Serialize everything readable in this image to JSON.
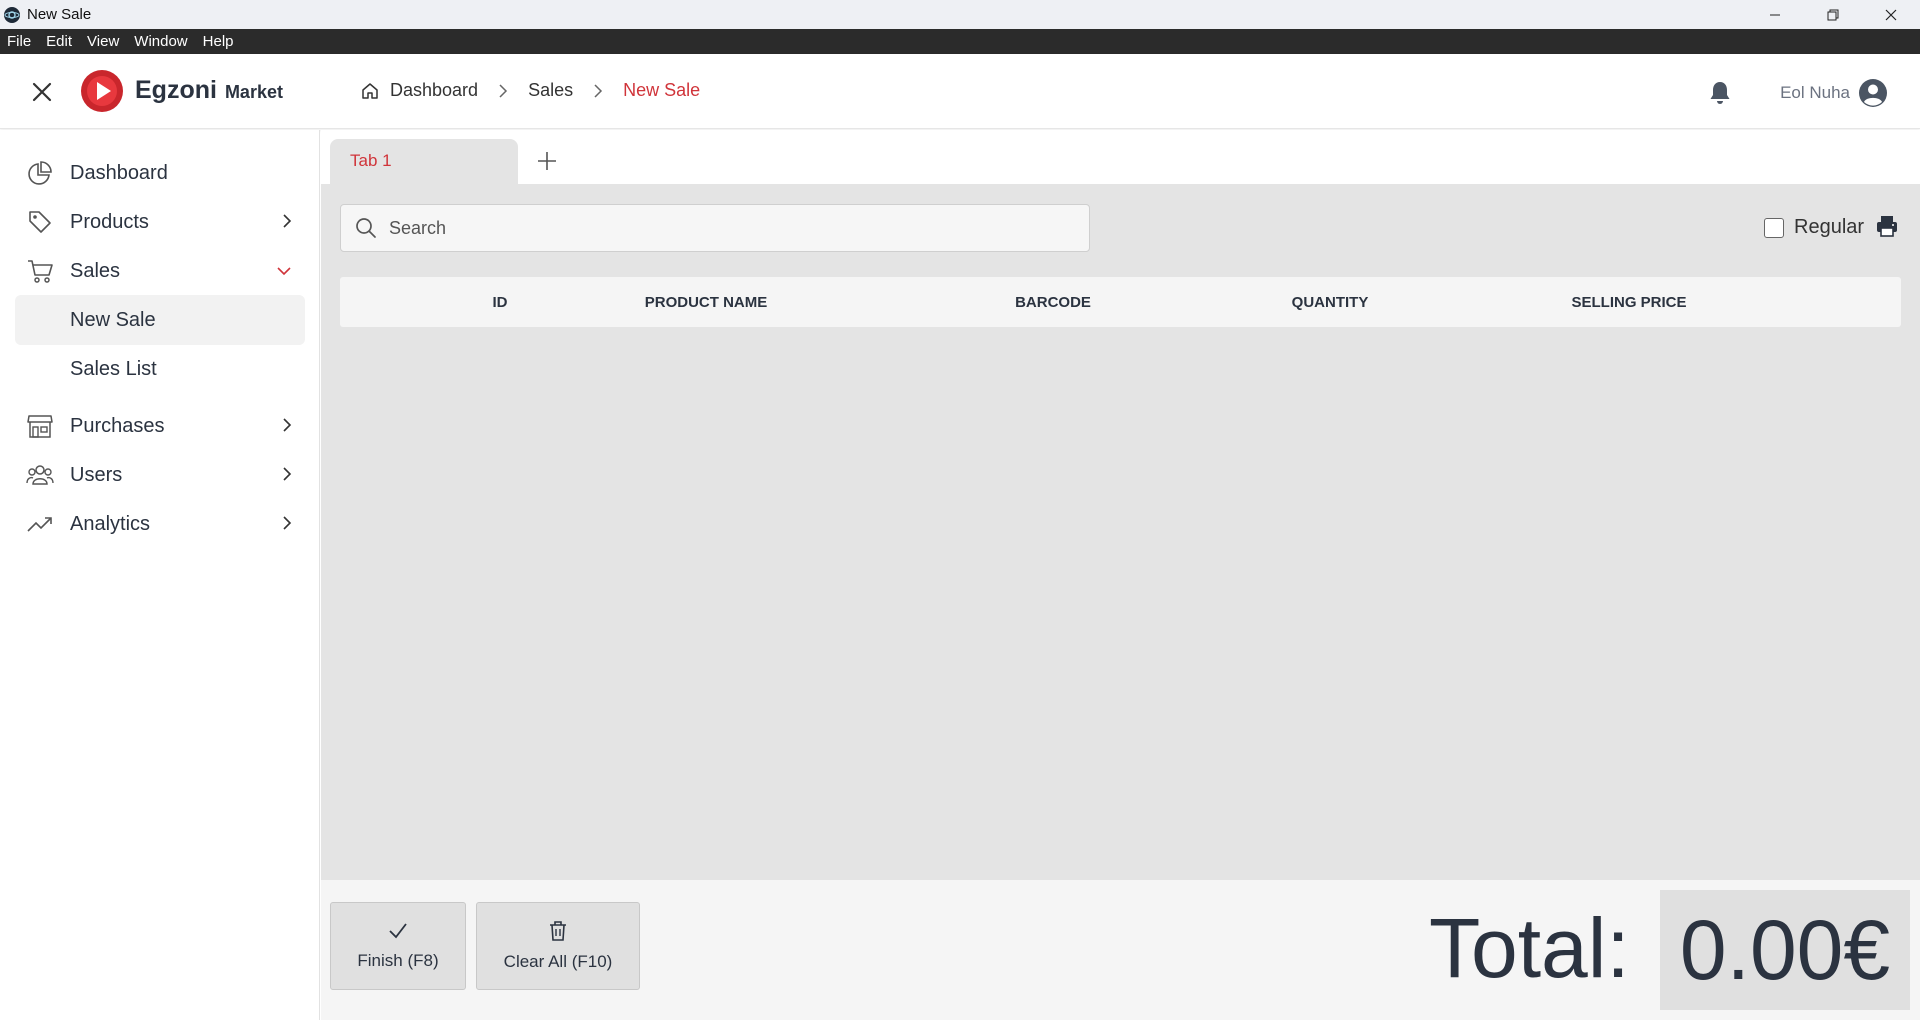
{
  "window": {
    "title": "New Sale"
  },
  "menu": [
    "File",
    "Edit",
    "View",
    "Window",
    "Help"
  ],
  "header": {
    "brand_main": "Egzoni",
    "brand_sub": "Market",
    "breadcrumb": [
      "Dashboard",
      "Sales",
      "New Sale"
    ],
    "user_name": "Eol Nuha"
  },
  "sidebar": {
    "items": [
      {
        "label": "Dashboard",
        "icon": "pie-chart-icon"
      },
      {
        "label": "Products",
        "icon": "tag-icon"
      },
      {
        "label": "Sales",
        "icon": "cart-icon",
        "expanded": true,
        "children": [
          "New Sale",
          "Sales List"
        ]
      },
      {
        "label": "Purchases",
        "icon": "store-icon"
      },
      {
        "label": "Users",
        "icon": "users-icon"
      },
      {
        "label": "Analytics",
        "icon": "trend-icon"
      }
    ],
    "active_child": "New Sale"
  },
  "tabs": {
    "items": [
      "Tab 1"
    ],
    "add_label": "+"
  },
  "search": {
    "placeholder": "Search",
    "value": ""
  },
  "regular_label": "Regular",
  "regular_checked": false,
  "table": {
    "columns": [
      "ID",
      "PRODUCT NAME",
      "BARCODE",
      "QUANTITY",
      "SELLING PRICE"
    ],
    "rows": []
  },
  "footer": {
    "finish_label": "Finish (F8)",
    "clear_label": "Clear All (F10)",
    "total_label": "Total:",
    "total_value": "0.00€"
  },
  "colors": {
    "accent": "#d0343a",
    "text": "#2b3340",
    "content_bg": "#e4e4e4"
  }
}
